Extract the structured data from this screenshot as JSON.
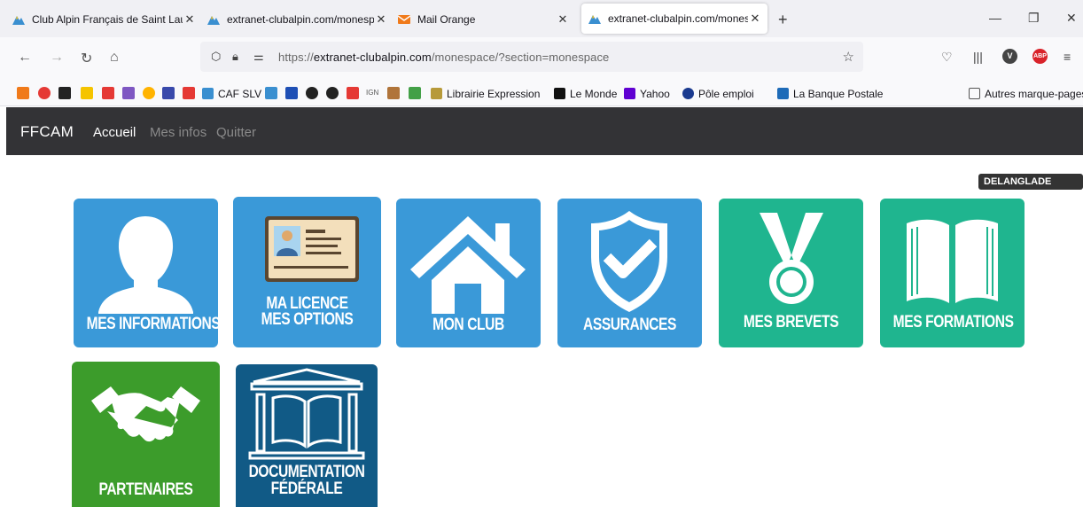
{
  "browser": {
    "tabs": [
      {
        "title": "Club Alpin Français de Saint Lau",
        "active": false
      },
      {
        "title": "extranet-clubalpin.com/monesp",
        "active": false
      },
      {
        "title": "Mail Orange",
        "active": false
      },
      {
        "title": "extranet-clubalpin.com/monesp",
        "active": true
      }
    ],
    "url_prefix": "https://",
    "url_domain": "extranet-clubalpin.com",
    "url_path": "/monespace/?section=monespace",
    "bookmarks": [
      {
        "label": "CAF SLV"
      },
      {
        "label": "Librairie Expression"
      },
      {
        "label": "Le Monde"
      },
      {
        "label": "Yahoo"
      },
      {
        "label": "Pôle emploi"
      },
      {
        "label": "La Banque Postale"
      },
      {
        "label": "Autres marque-pages"
      }
    ],
    "bookmark_icon_labels": {
      "ign": "IGN"
    },
    "abp_label": "ABP"
  },
  "site": {
    "brand": "FFCAM",
    "nav": [
      {
        "label": "Accueil",
        "active": true
      },
      {
        "label": "Mes infos",
        "active": false
      },
      {
        "label": "Quitter",
        "active": false
      }
    ],
    "user": "DELANGLADE YVES",
    "tiles": [
      {
        "line1": "MES INFORMATIONS",
        "line2": "",
        "color": "#3a99d8",
        "icon": "user-icon"
      },
      {
        "line1": "MA LICENCE",
        "line2": "MES OPTIONS",
        "color": "#3a99d8",
        "icon": "id-card-icon"
      },
      {
        "line1": "MON CLUB",
        "line2": "",
        "color": "#3a99d8",
        "icon": "house-icon"
      },
      {
        "line1": "ASSURANCES",
        "line2": "",
        "color": "#3a99d8",
        "icon": "shield-check-icon"
      },
      {
        "line1": "MES BREVETS",
        "line2": "",
        "color": "#1fb58f",
        "icon": "medal-icon"
      },
      {
        "line1": "MES FORMATIONS",
        "line2": "",
        "color": "#1fb58f",
        "icon": "open-book-icon"
      },
      {
        "line1": "PARTENAIRES",
        "line2": "",
        "color": "#3c9c2b",
        "icon": "handshake-icon"
      },
      {
        "line1": "DOCUMENTATION",
        "line2": "FÉDÉRALE",
        "color": "#115a86",
        "icon": "book-pillar-icon"
      }
    ]
  }
}
